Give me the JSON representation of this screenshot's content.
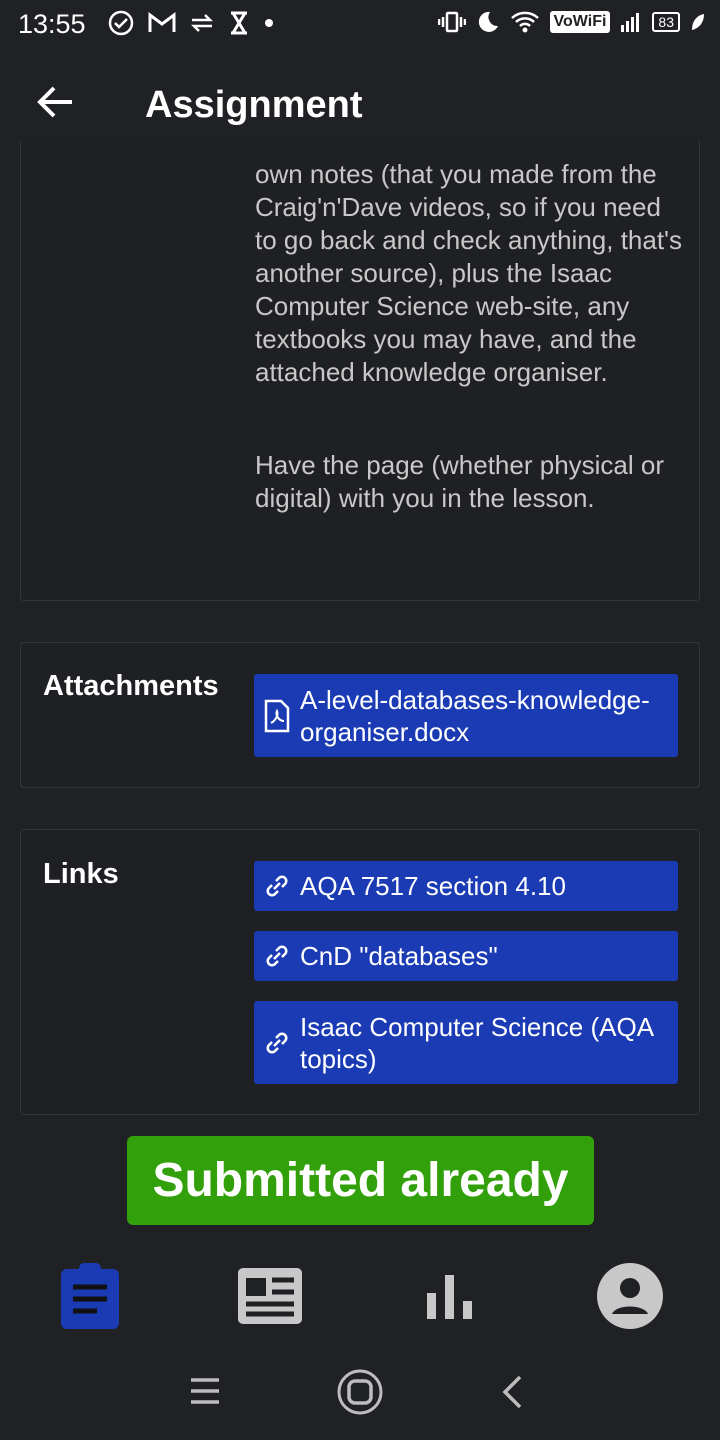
{
  "status_bar": {
    "time": "13:55",
    "vowifi": "VoWiFi",
    "battery": "83"
  },
  "app_bar": {
    "title": "Assignment",
    "back_icon": "arrow-back-icon"
  },
  "description": {
    "paragraph1": "own notes (that you made from the Craig'n'Dave videos, so if you need to go back and check anything, that's another source), plus the Isaac Computer Science web-site, any textbooks you may have, and the attached knowledge organiser.",
    "paragraph2": "Have the page (whether physical or digital) with you in the lesson."
  },
  "attachments": {
    "label": "Attachments",
    "items": [
      {
        "name": "A-level-databases-knowledge-organiser.docx",
        "icon": "pdf-file-icon"
      }
    ]
  },
  "links": {
    "label": "Links",
    "items": [
      {
        "label": "AQA 7517 section 4.10",
        "icon": "link-icon"
      },
      {
        "label": "CnD \"databases\"",
        "icon": "link-icon"
      },
      {
        "label": "Isaac Computer Science (AQA topics)",
        "icon": "link-icon"
      }
    ]
  },
  "submit_status": {
    "label": "Submitted already",
    "color": "#32a00a"
  },
  "bottom_nav": {
    "items": [
      {
        "icon": "assignment-icon",
        "active": true
      },
      {
        "icon": "newspaper-icon",
        "active": false
      },
      {
        "icon": "bar-chart-icon",
        "active": false
      },
      {
        "icon": "account-icon",
        "active": false
      }
    ]
  },
  "colors": {
    "accent": "#1a3bb3",
    "background": "#202124",
    "success": "#32a00a"
  }
}
